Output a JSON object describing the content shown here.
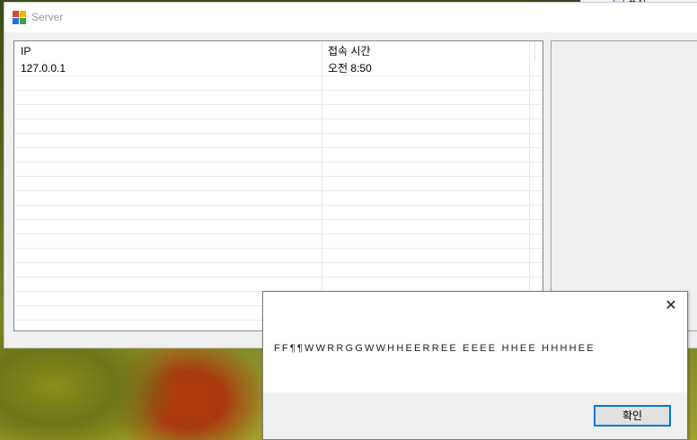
{
  "background_window": {
    "label": "표시"
  },
  "window": {
    "title": "Server",
    "icon": "app-window-icon"
  },
  "listview": {
    "columns": [
      "IP",
      "접속 시간"
    ],
    "rows": [
      {
        "ip": "127.0.0.1",
        "time": "오전 8:50"
      }
    ]
  },
  "dialog": {
    "message": "FF¶¶WWRRGGWWHHEERREE EEEE HHEE HHHHEE",
    "ok_label": "확인",
    "close_icon": "close-icon"
  },
  "colors": {
    "accent": "#0078d7",
    "window_bg": "#f0f0f0",
    "title_text": "#999999"
  }
}
